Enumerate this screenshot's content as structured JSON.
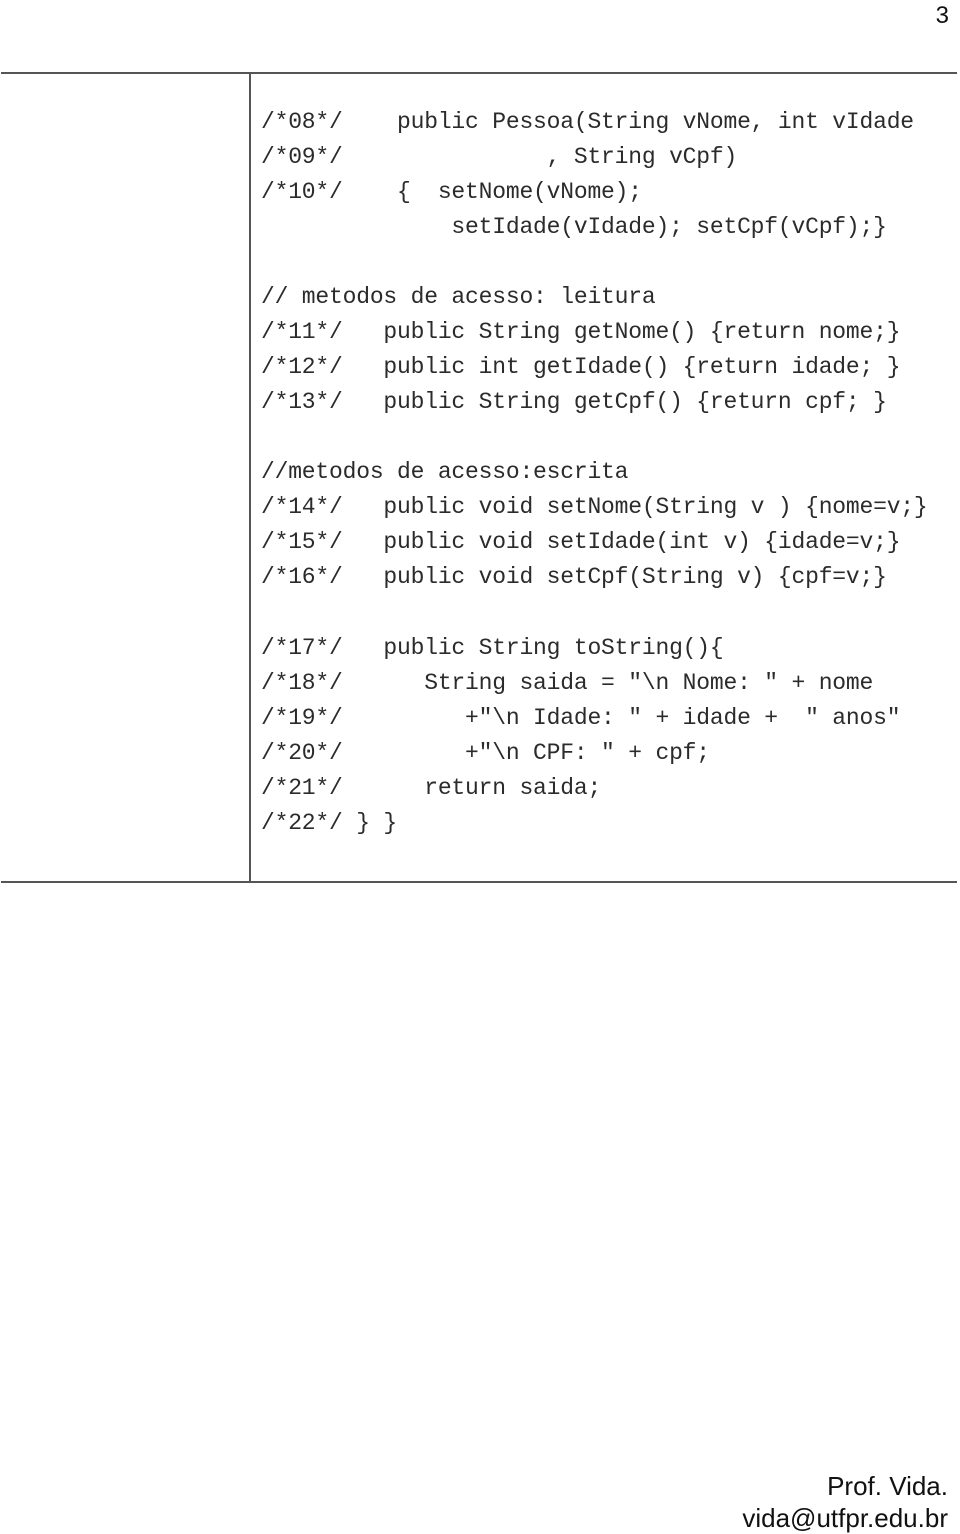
{
  "page": {
    "number": "3"
  },
  "code": {
    "lines": [
      "/*08*/    public Pessoa(String vNome, int vIdade",
      "/*09*/               , String vCpf)",
      "/*10*/    {  setNome(vNome);",
      "              setIdade(vIdade); setCpf(vCpf);}",
      "",
      "// metodos de acesso: leitura",
      "/*11*/   public String getNome() {return nome;}",
      "/*12*/   public int getIdade() {return idade; }",
      "/*13*/   public String getCpf() {return cpf; }",
      "",
      "//metodos de acesso:escrita",
      "/*14*/   public void setNome(String v ) {nome=v;}",
      "/*15*/   public void setIdade(int v) {idade=v;}",
      "/*16*/   public void setCpf(String v) {cpf=v;}",
      "",
      "/*17*/   public String toString(){",
      "/*18*/      String saida = \"\\n Nome: \" + nome",
      "/*19*/         +\"\\n Idade: \" + idade +  \" anos\"",
      "/*20*/         +\"\\n CPF: \" + cpf;",
      "/*21*/      return saida;",
      "/*22*/ } }"
    ]
  },
  "footer": {
    "author": "Prof. Vida.",
    "email": "vida@utfpr.edu.br"
  }
}
